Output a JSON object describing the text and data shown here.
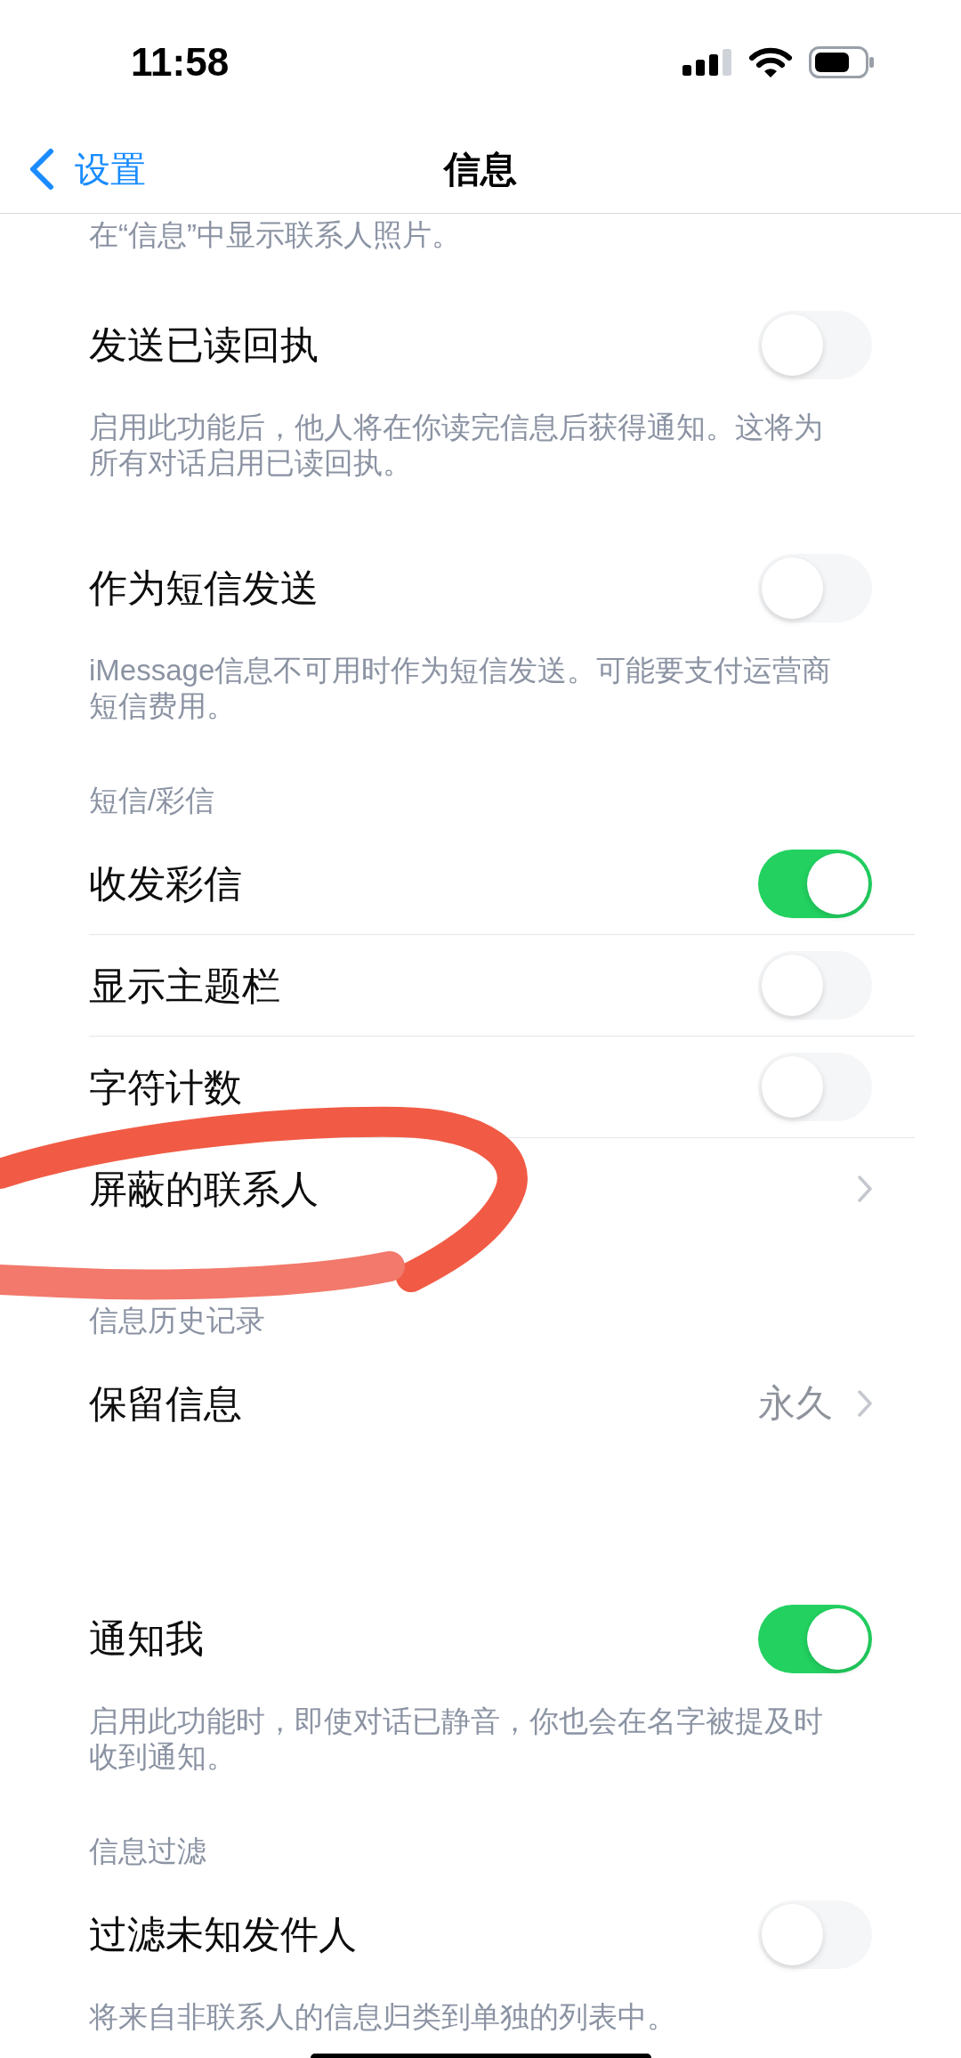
{
  "status_bar": {
    "time": "11:58"
  },
  "nav_bar": {
    "back_label": "设置",
    "title": "信息"
  },
  "top_note": "在“信息”中显示联系人照片。",
  "groups": [
    {
      "rows": [
        {
          "kind": "toggle",
          "label": "发送已读回执",
          "on": false
        }
      ],
      "footer": "启用此功能后，他人将在你读完信息后获得通知。这将为所有对话启用已读回执。"
    },
    {
      "rows": [
        {
          "kind": "toggle",
          "label": "作为短信发送",
          "on": false
        }
      ],
      "footer": "iMessage信息不可用时作为短信发送。可能要支付运营商短信费用。"
    },
    {
      "header": "短信/彩信",
      "rows": [
        {
          "kind": "toggle",
          "label": "收发彩信",
          "on": true
        },
        {
          "kind": "toggle",
          "label": "显示主题栏",
          "on": false
        },
        {
          "kind": "toggle",
          "label": "字符计数",
          "on": false
        },
        {
          "kind": "link",
          "label": "屏蔽的联系人"
        }
      ]
    },
    {
      "header": "信息历史记录",
      "rows": [
        {
          "kind": "link",
          "label": "保留信息",
          "value": "永久"
        }
      ]
    },
    {
      "rows": [
        {
          "kind": "toggle",
          "label": "通知我",
          "on": true
        }
      ],
      "footer": "启用此功能时，即使对话已静音，你也会在名字被提及时收到通知。"
    },
    {
      "header": "信息过滤",
      "rows": [
        {
          "kind": "toggle",
          "label": "过滤未知发件人",
          "on": false
        }
      ],
      "footer": "将来自非联系人的信息归类到单独的列表中。"
    }
  ]
}
